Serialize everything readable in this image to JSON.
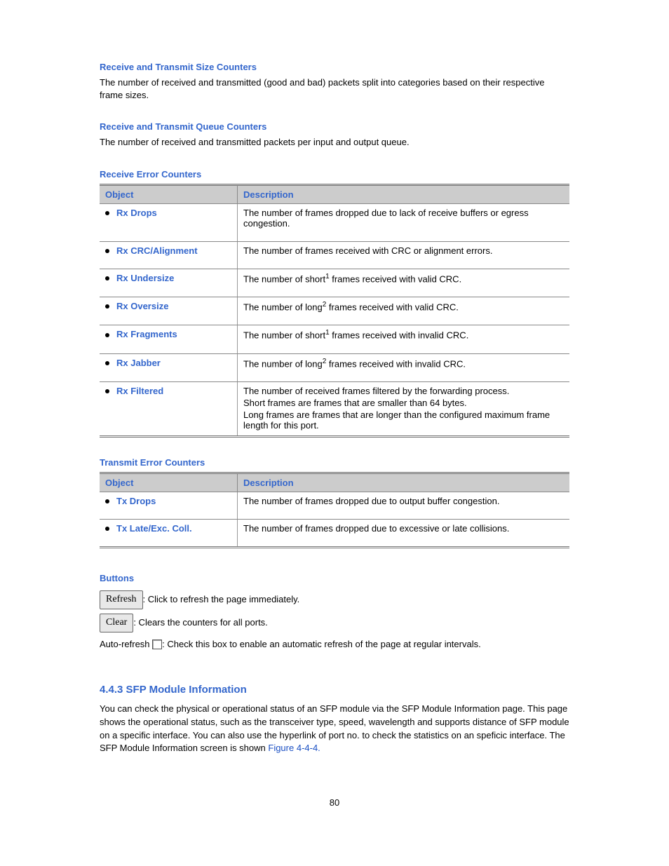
{
  "sections": {
    "sizeCounters": {
      "heading": "Receive and Transmit Size Counters",
      "text": "The number of received and transmitted (good and bad) packets split into categories based on their respective frame sizes."
    },
    "queueCounters": {
      "heading": "Receive and Transmit Queue Counters",
      "text": "The number of received and transmitted packets per input and output queue."
    },
    "rxErrorHeading": "Receive Error Counters",
    "txErrorHeading": "Transmit Error Counters"
  },
  "rxTable": {
    "headers": {
      "obj": "Object",
      "desc": "Description"
    },
    "rows": [
      {
        "obj": "Rx Drops",
        "desc": "The number of frames dropped due to lack of receive buffers or egress congestion."
      },
      {
        "obj": "Rx CRC/Alignment",
        "desc": "The number of frames received with CRC or alignment errors."
      },
      {
        "obj": "Rx Undersize",
        "desc": "The number of short 1 frames received with valid CRC.",
        "sup": true
      },
      {
        "obj": "Rx Oversize",
        "desc": "The number of long 2 frames received with valid CRC.",
        "sup": true
      },
      {
        "obj": "Rx Fragments",
        "desc": "The number of short 1 frames received with invalid CRC.",
        "sup": true
      },
      {
        "obj": "Rx Jabber",
        "desc": "The number of long 2 frames received with invalid CRC.",
        "sup": true
      },
      {
        "obj": "Rx Filtered",
        "descLines": [
          "The number of received frames filtered by the forwarding process.",
          "Short frames are frames that are smaller than 64 bytes.",
          "Long frames are frames that are longer than the configured maximum frame length for this port."
        ]
      }
    ]
  },
  "txTable": {
    "headers": {
      "obj": "Object",
      "desc": "Description"
    },
    "rows": [
      {
        "obj": "Tx Drops",
        "desc": "The number of frames dropped due to output buffer congestion."
      },
      {
        "obj": "Tx Late/Exc. Coll.",
        "desc": "The number of frames dropped due to excessive or late collisions."
      }
    ]
  },
  "buttons": {
    "heading": "Buttons",
    "refresh": {
      "label": "Refresh",
      "text": ": Click to refresh the page immediately."
    },
    "clear": {
      "label": "Clear",
      "text": ": Clears the counters for all ports."
    },
    "auto": {
      "prefix": "Auto-refresh",
      "text": ": Check this box to enable an automatic refresh of the page at regular intervals."
    }
  },
  "sfp": {
    "heading": "4.4.3 SFP Module Information",
    "text": "You can check the physical or operational status of an SFP module via the SFP Module Information page. This page shows the operational status, such as the transceiver type, speed, wavelength and supports distance of SFP module on a specific interface. You can also use the hyperlink of port no. to check the statistics on an speficic interface. The SFP Module Information screen is shown ",
    "figref": "Figure 4-4-4."
  },
  "pageNumber": "80"
}
